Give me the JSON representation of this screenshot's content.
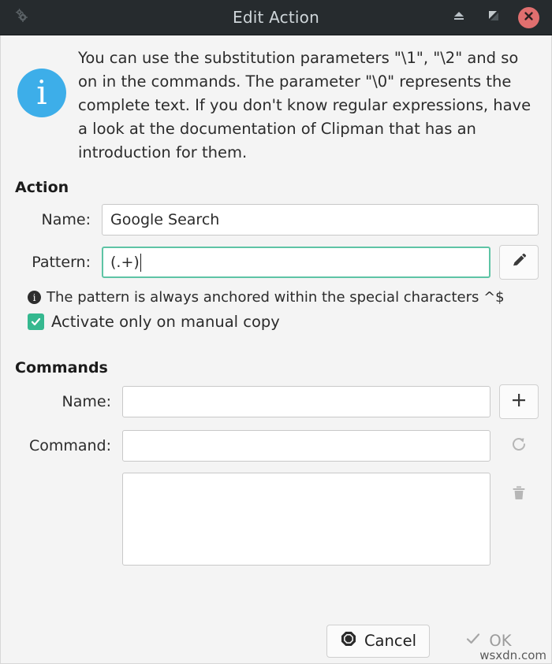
{
  "titlebar": {
    "title": "Edit Action",
    "app_icon": "gears-icon",
    "shade_label": "",
    "maximize_label": "",
    "close_label": "",
    "close_color": "#e06f6f",
    "background": "#262b2e"
  },
  "info": {
    "icon": "info-icon",
    "icon_color": "#3daee9",
    "text": "You can use the substitution parameters \"\\1\", \"\\2\" and so on in the commands. The parameter \"\\0\" represents the complete text. If you don't know regular expressions, have a look at the documentation of Clipman that has an introduction for them."
  },
  "action": {
    "heading": "Action",
    "name_label": "Name:",
    "name_value": "Google Search",
    "name_placeholder": "",
    "pattern_label": "Pattern:",
    "pattern_value": "(.+)",
    "pattern_placeholder": "",
    "pattern_focus_color": "#5ec4a5",
    "edit_button_icon": "pencil-icon",
    "hint_icon": "info-icon",
    "hint_text": "The pattern is always anchored within the special characters ^$",
    "checkbox_label": "Activate only on manual copy",
    "checkbox_checked": true,
    "checkbox_color": "#35b88f"
  },
  "commands": {
    "heading": "Commands",
    "name_label": "Name:",
    "name_value": "",
    "name_placeholder": "",
    "add_button_icon": "plus-icon",
    "command_label": "Command:",
    "command_value": "",
    "command_placeholder": "",
    "refresh_button_icon": "refresh-icon",
    "delete_button_icon": "trash-icon",
    "list_items": []
  },
  "footer": {
    "cancel_label": "Cancel",
    "cancel_icon": "stop-icon",
    "ok_label": "OK",
    "ok_icon": "check-icon",
    "ok_disabled": true
  },
  "watermark": "wsxdn.com"
}
